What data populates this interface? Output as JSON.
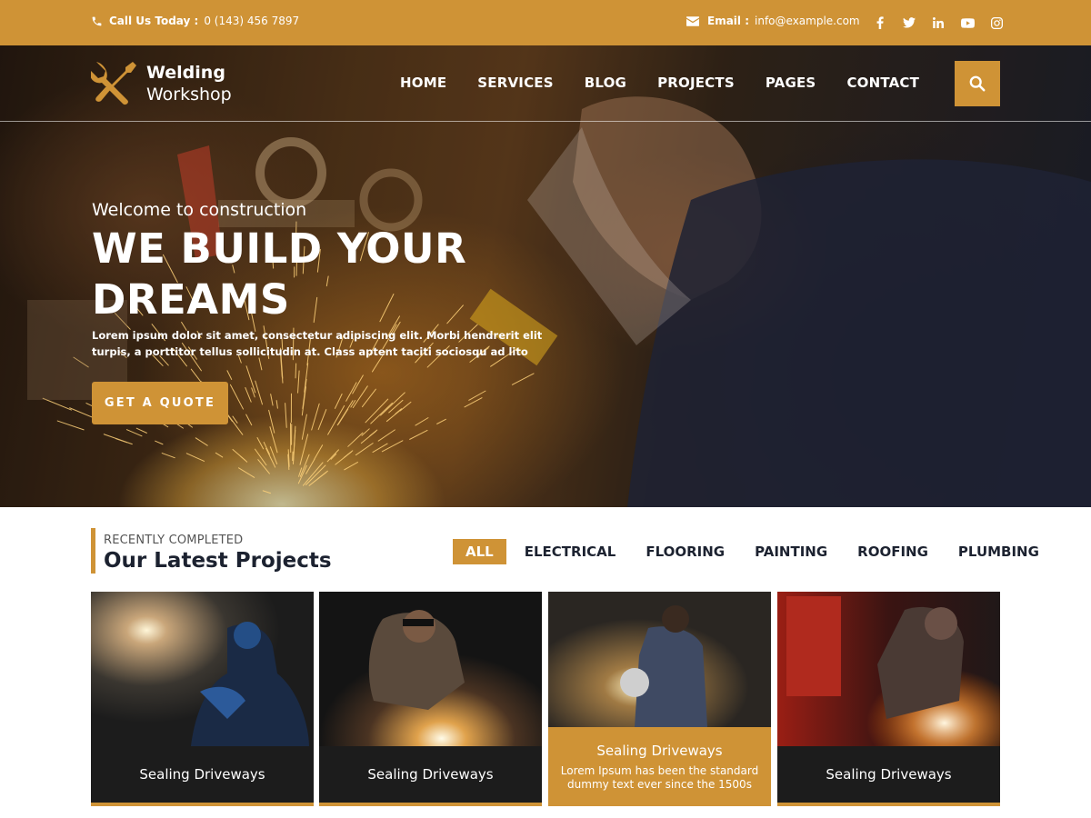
{
  "topbar": {
    "call_label": "Call Us Today :",
    "call_value": "0 (143) 456 7897",
    "email_label": "Email :",
    "email_value": "info@example.com",
    "social": [
      "facebook-icon",
      "twitter-icon",
      "linkedin-icon",
      "youtube-icon",
      "instagram-icon"
    ]
  },
  "brand": {
    "line1": "Welding",
    "line2": "Workshop"
  },
  "nav": {
    "items": [
      "HOME",
      "SERVICES",
      "BLOG",
      "PROJECTS",
      "PAGES",
      "CONTACT"
    ]
  },
  "hero": {
    "kicker": "Welcome to construction",
    "title_line1": "WE BUILD YOUR",
    "title_line2": "DREAMS",
    "text": "Lorem ipsum dolor sit amet, consectetur adipiscing elit. Morbi hendrerit elit turpis, a porttitor tellus sollicitudin at. Class aptent taciti sociosqu ad lito",
    "cta": "GET A QUOTE"
  },
  "projects": {
    "kicker": "RECENTLY COMPLETED",
    "title": "Our Latest Projects",
    "filters": [
      "ALL",
      "ELECTRICAL",
      "FLOORING",
      "PAINTING",
      "ROOFING",
      "PLUMBING"
    ],
    "cards": [
      {
        "title": "Sealing Driveways"
      },
      {
        "title": "Sealing Driveways"
      },
      {
        "title": "Sealing Driveways",
        "desc": "Lorem Ipsum has been the  standard dummy text ever since the 1500s"
      },
      {
        "title": "Sealing Driveways"
      }
    ]
  },
  "colors": {
    "accent": "#cf9336",
    "dark": "#1c2230",
    "card": "#1c1c1c"
  }
}
